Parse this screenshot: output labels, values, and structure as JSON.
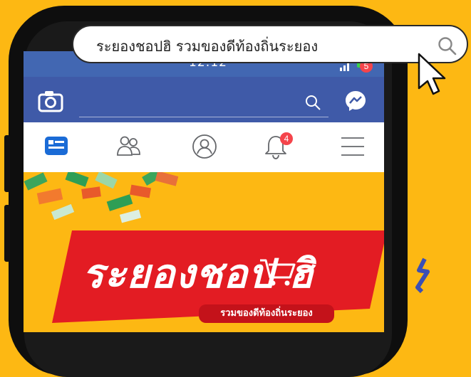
{
  "status_bar": {
    "time": "12:12"
  },
  "app_bar": {
    "messenger_badge": "5"
  },
  "tabs": [
    {
      "name": "news-feed",
      "icon": "news-feed-icon"
    },
    {
      "name": "friends",
      "icon": "friends-icon"
    },
    {
      "name": "profile",
      "icon": "profile-icon"
    },
    {
      "name": "notifications",
      "icon": "bell-icon",
      "badge": "4"
    },
    {
      "name": "menu",
      "icon": "hamburger-icon"
    }
  ],
  "promo": {
    "logo_text": "ระยองชอป ฮิ",
    "subtitle": "รวมของดีท้องถิ่นระยอง"
  },
  "search_pill": {
    "query": "ระยองชอปฮิ รวมของดีท้องถิ่นระยอง"
  },
  "colors": {
    "background": "#FDB813",
    "facebook_blue": "#3F5AA8",
    "badge_red": "#F5444B",
    "logo_red": "#E31C23"
  }
}
